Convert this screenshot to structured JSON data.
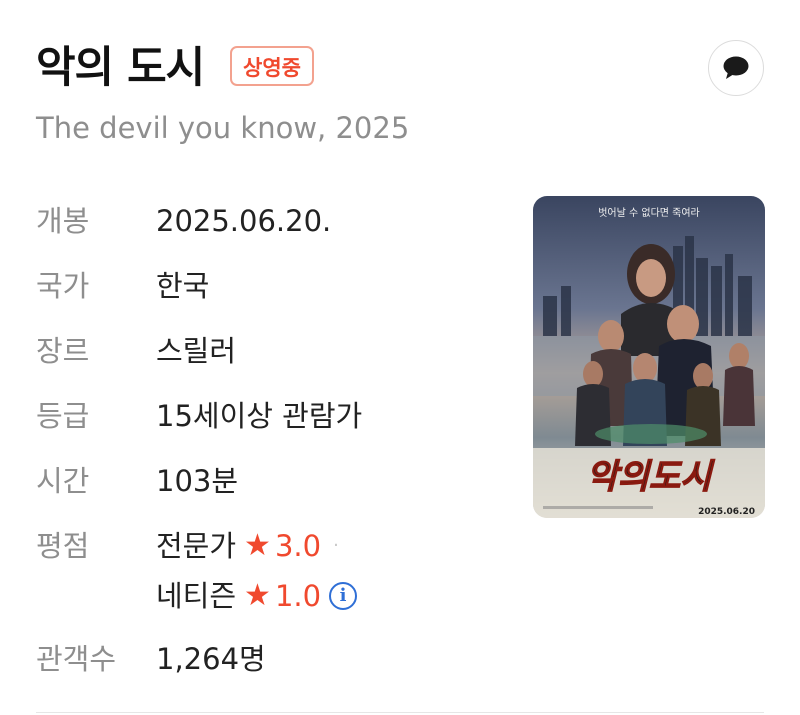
{
  "movie": {
    "title": "악의 도시",
    "status_badge": "상영중",
    "subtitle": "The devil you know, 2025"
  },
  "details": [
    {
      "label": "개봉",
      "value": "2025.06.20."
    },
    {
      "label": "국가",
      "value": "한국"
    },
    {
      "label": "장르",
      "value": "스릴러"
    },
    {
      "label": "등급",
      "value": "15세이상 관람가"
    },
    {
      "label": "시간",
      "value": "103분"
    }
  ],
  "rating": {
    "label": "평점",
    "critic_source": "전문가",
    "critic_score": "3.0",
    "netizen_source": "네티즌",
    "netizen_score": "1.0"
  },
  "audience": {
    "label": "관객수",
    "value": "1,264명"
  },
  "poster": {
    "tagline": "벗어날 수 없다면 죽여라",
    "title": "악의도시",
    "date": "2025.06.20"
  },
  "colors": {
    "accent": "#f0492e",
    "info": "#2f6fd6"
  },
  "icons": {
    "comment": "speech-bubble-icon",
    "star": "star-icon",
    "info": "info-circle-icon"
  }
}
